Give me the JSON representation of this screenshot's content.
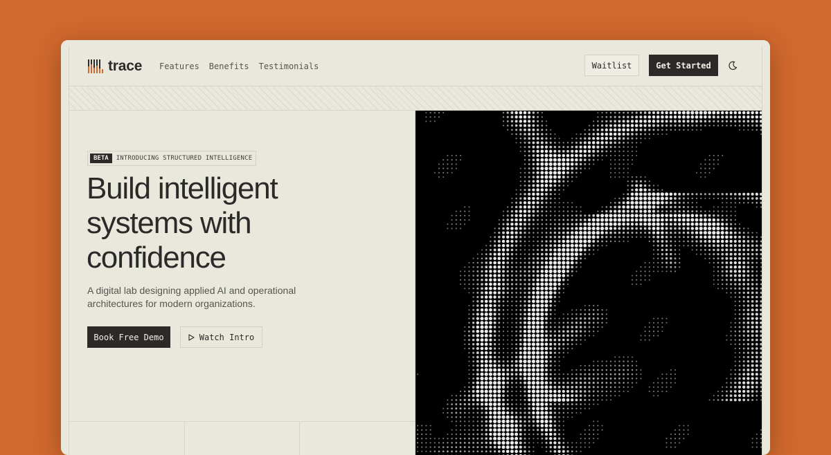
{
  "brand": {
    "name": "trace",
    "accent": "#d2692e",
    "dark": "#2b2a28",
    "paper": "#e9e8dd"
  },
  "nav": {
    "links": [
      "Features",
      "Benefits",
      "Testimonials"
    ],
    "waitlist_label": "Waitlist",
    "get_started_label": "Get Started",
    "theme_icon": "moon-icon"
  },
  "hero": {
    "badge_tag": "BETA",
    "badge_text": "INTRODUCING STRUCTURED INTELLIGENCE",
    "headline_lines": [
      "Build intelligent",
      "systems with",
      "confidence"
    ],
    "subhead": "A digital lab designing applied AI and operational architectures for modern organizations.",
    "primary_cta": "Book Free Demo",
    "secondary_cta": "Watch Intro",
    "secondary_icon": "play-icon",
    "visual": "dot-matrix-portrait"
  }
}
